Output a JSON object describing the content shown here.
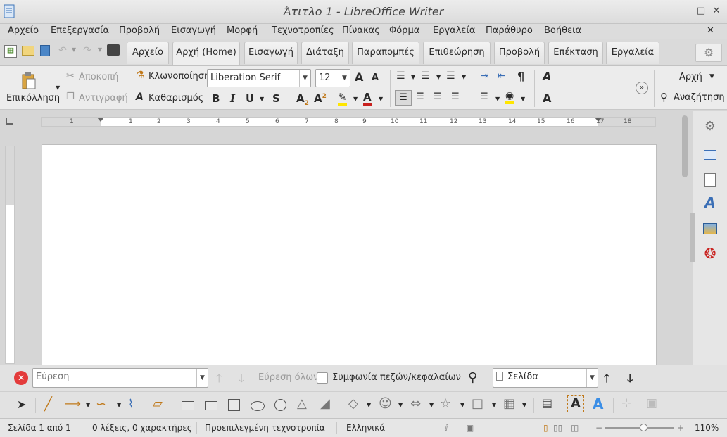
{
  "window": {
    "title": "Άτιτλο 1 - LibreOffice Writer"
  },
  "menu": [
    "Αρχείο",
    "Επεξεργασία",
    "Προβολή",
    "Εισαγωγή",
    "Μορφή",
    "Τεχνοτροπίες",
    "Πίνακας",
    "Φόρμα",
    "Εργαλεία",
    "Παράθυρο",
    "Βοήθεια"
  ],
  "tabs": [
    "Αρχείο",
    "Αρχή (Home)",
    "Εισαγωγή",
    "Διάταξη",
    "Παραπομπές",
    "Επιθεώρηση",
    "Προβολή",
    "Επέκταση",
    "Εργαλεία"
  ],
  "active_tab": "Αρχή (Home)",
  "ribbon": {
    "paste": "Επικόλληση",
    "cut": "Αποκοπή",
    "copy": "Αντιγραφή",
    "clone": "Κλωνοποίηση",
    "clear": "Καθαρισμός",
    "font_name": "Liberation Serif",
    "font_size": "12",
    "style": "Αρχή",
    "find": "Αναζήτηση",
    "bold": "B",
    "italic": "I",
    "underline": "U",
    "strike": "S"
  },
  "ruler": {
    "ticks": [
      "1",
      "1",
      "2",
      "3",
      "4",
      "5",
      "6",
      "7",
      "8",
      "9",
      "10",
      "11",
      "12",
      "13",
      "14",
      "15",
      "16",
      "17",
      "18"
    ]
  },
  "findbar": {
    "placeholder": "Εύρεση",
    "find_all": "Εύρεση όλων",
    "match_case": "Συμφωνία πεζών/κεφαλαίων",
    "nav_target": "Σελίδα"
  },
  "status": {
    "page": "Σελίδα 1 από 1",
    "words": "0 λέξεις, 0 χαρακτήρες",
    "style": "Προεπιλεγμένη τεχνοτροπία",
    "language": "Ελληνικά",
    "zoom": "110%"
  },
  "zoom_level": 0.55,
  "colors": {
    "highlight": "#ffe600",
    "font_color": "#c9211e",
    "close_red": "#e33b3b"
  }
}
